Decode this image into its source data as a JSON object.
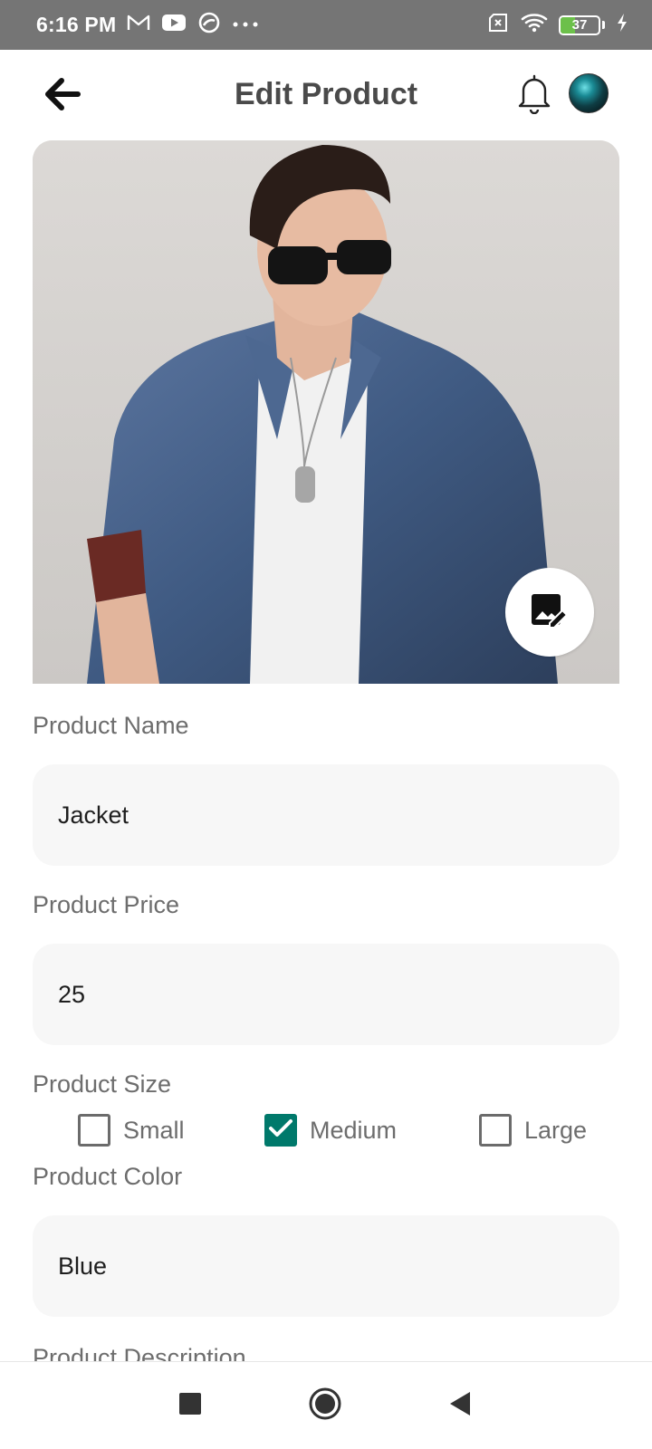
{
  "status_bar": {
    "time": "6:16 PM",
    "left_icons": [
      "gmail-icon",
      "youtube-icon",
      "no-disturb-icon",
      "more-dots-icon"
    ],
    "right_icons": [
      "no-sim-icon",
      "wifi-icon",
      "battery-icon",
      "charging-icon"
    ],
    "battery_level": "37",
    "battery_fraction": 0.37
  },
  "app_bar": {
    "title": "Edit Product",
    "back_icon": "arrow-left-icon",
    "notification_icon": "bell-icon"
  },
  "product_image": {
    "edit_icon": "edit-image-icon"
  },
  "form": {
    "name": {
      "label": "Product Name",
      "value": "Jacket"
    },
    "price": {
      "label": "Product Price",
      "value": "25"
    },
    "size": {
      "label": "Product Size",
      "options": [
        {
          "label": "Small",
          "checked": false
        },
        {
          "label": "Medium",
          "checked": true
        },
        {
          "label": "Large",
          "checked": false
        }
      ]
    },
    "color": {
      "label": "Product Color",
      "value": "Blue"
    },
    "description": {
      "label": "Product Description"
    }
  },
  "nav_bar": {
    "icons": [
      "recents-square-icon",
      "home-circle-icon",
      "back-triangle-icon"
    ]
  },
  "colors": {
    "accent": "#00796b",
    "status_bar_bg": "#757575",
    "field_bg": "#f7f7f7",
    "label_gray": "#6d6d6d"
  }
}
